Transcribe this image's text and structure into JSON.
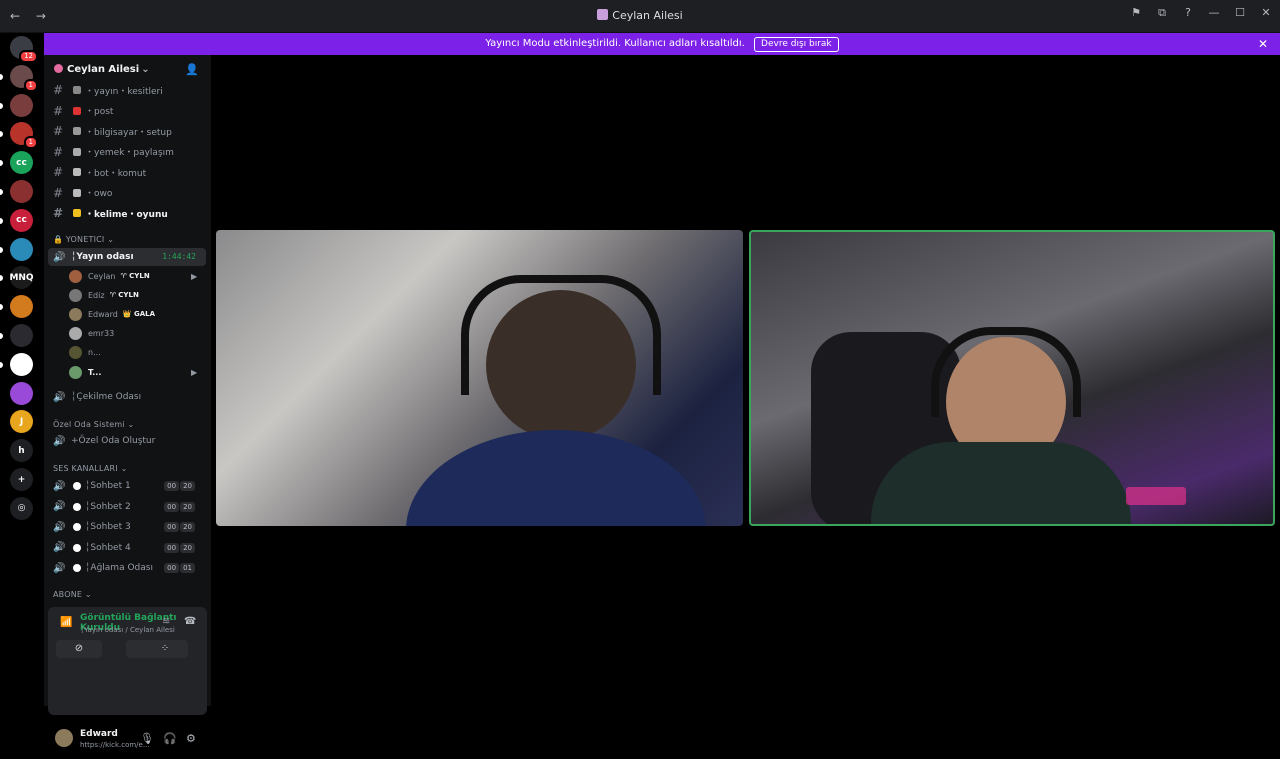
{
  "window": {
    "title": "Ceylan Ailesi",
    "nav": "← →",
    "tools": [
      "⚑",
      "⧉",
      "?",
      "—",
      "☐",
      "✕"
    ]
  },
  "banner": {
    "text": "Yayıncı Modu etkinleştirildi. Kullanıcı adları kısaltıldı.",
    "button": "Devre dışı bırak",
    "close": "✕"
  },
  "guilds": [
    {
      "txt": "",
      "badge": "12",
      "color": "#3b3d44"
    },
    {
      "txt": "",
      "badge": "1",
      "color": "#6a4a4a"
    },
    {
      "txt": "",
      "badge": "",
      "color": "#7a3d3d"
    },
    {
      "txt": "",
      "badge": "1",
      "color": "#b8342b"
    },
    {
      "txt": "cc",
      "badge": "",
      "color": "#19a35b"
    },
    {
      "txt": "",
      "badge": "",
      "color": "#8a3030"
    },
    {
      "txt": "cc",
      "badge": "",
      "color": "#c8203a"
    },
    {
      "txt": "",
      "badge": "",
      "color": "#2a8ab8"
    },
    {
      "txt": "MNQ",
      "badge": "",
      "color": "#1b1b1b"
    },
    {
      "txt": "",
      "badge": "",
      "color": "#d27a1e"
    },
    {
      "txt": "",
      "badge": "",
      "color": "#2a2a30"
    },
    {
      "txt": "",
      "badge": "",
      "color": "#ffffff"
    },
    {
      "txt": "",
      "badge": "",
      "color": "#9a4ad8"
    },
    {
      "txt": "J",
      "badge": "",
      "color": "#e8a51e"
    },
    {
      "txt": "h",
      "badge": "",
      "color": "#1e1f22"
    },
    {
      "txt": "+",
      "badge": "",
      "color": "#1e1f22"
    },
    {
      "txt": "◎",
      "badge": "",
      "color": "#1e1f22"
    }
  ],
  "server": {
    "name": "Ceylan Ailesi",
    "chevron": "⌄",
    "add_user": "👤"
  },
  "text_channels": [
    {
      "name": "・yayın・kesitleri",
      "color": "#888",
      "unread": false
    },
    {
      "name": "・post",
      "color": "#d33",
      "unread": false
    },
    {
      "name": "・bilgisayar・setup",
      "color": "#999",
      "unread": false
    },
    {
      "name": "・yemek・paylaşım",
      "color": "#aaa",
      "unread": false
    },
    {
      "name": "・bot・komut",
      "color": "#bbb",
      "unread": false
    },
    {
      "name": "・owo",
      "color": "#bbb",
      "unread": false
    },
    {
      "name": "・kelime・oyunu",
      "color": "#f0c020",
      "unread": true
    }
  ],
  "category_yonetici": "YONETICI",
  "active_voice": {
    "name": "╎Yayın odası",
    "timer": "1:44:42"
  },
  "voice_users": [
    {
      "name": "Ceylan",
      "tag": "♈ CYLN",
      "cam": true,
      "color": "#a06040"
    },
    {
      "name": "Ediz",
      "tag": "♈ CYLN",
      "cam": false,
      "color": "#777"
    },
    {
      "name": "Edward",
      "tag": "👑 GALA",
      "cam": false,
      "color": "#8c7a5c"
    },
    {
      "name": "emr33",
      "tag": "",
      "cam": false,
      "color": "#aaa"
    },
    {
      "name": "n...",
      "tag": "",
      "cam": false,
      "color": "#553"
    },
    {
      "name": "T...",
      "tag": "",
      "cam": true,
      "color": "#6a9a6a"
    }
  ],
  "cekilme": "╎Çekilme Odası",
  "category_ozel": "Özel Oda Sistemi",
  "ozel_olustur": "Özel Oda Oluştur",
  "category_ses": "SES KANALLARI",
  "voice_channels": [
    {
      "name": "╎Sohbet 1",
      "a": "00",
      "b": "20"
    },
    {
      "name": "╎Sohbet 2",
      "a": "00",
      "b": "20"
    },
    {
      "name": "╎Sohbet 3",
      "a": "00",
      "b": "20"
    },
    {
      "name": "╎Sohbet 4",
      "a": "00",
      "b": "20"
    },
    {
      "name": "╎Ağlama Odası",
      "a": "00",
      "b": "01"
    }
  ],
  "category_abone": "ABONE",
  "connection": {
    "status": "Görüntülü Bağlantı Kuruldu",
    "sub": "╎Yayın odası / Ceylan Ailesi"
  },
  "panel_buttons": [
    "⊘",
    "⬒",
    "⁘"
  ],
  "me": {
    "name": "Edward",
    "status": "https://kick.com/e...",
    "mic": "🎙",
    "headset": "🎧",
    "settings": "⚙"
  }
}
